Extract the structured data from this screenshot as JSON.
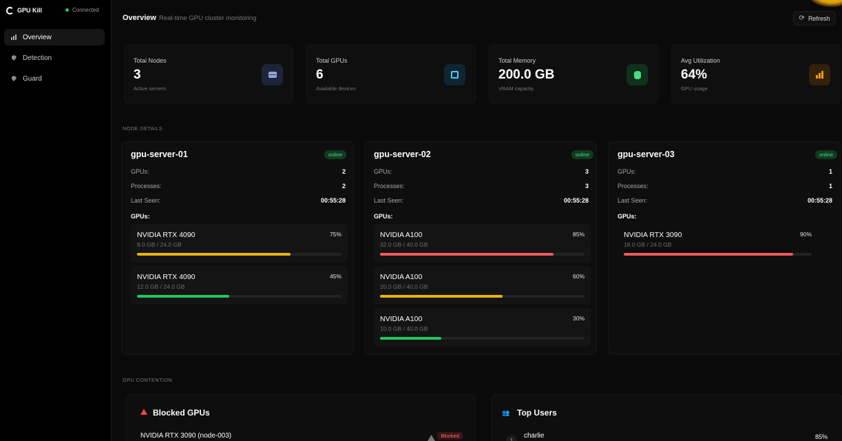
{
  "app": {
    "name": "GPU Kill",
    "status": "Connected"
  },
  "sidebar": {
    "items": [
      {
        "label": "Overview"
      },
      {
        "label": "Detection"
      },
      {
        "label": "Guard"
      }
    ]
  },
  "header": {
    "title": "Overview",
    "subtitle": "Real-time GPU cluster monitoring",
    "refresh_label": "Refresh"
  },
  "stats": [
    {
      "label": "Total Nodes",
      "value": "3",
      "sub": "Active servers",
      "icon": "server-icon",
      "color": "#93a7d8"
    },
    {
      "label": "Total GPUs",
      "value": "6",
      "sub": "Available devices",
      "icon": "chip-icon",
      "color": "#55c7f0"
    },
    {
      "label": "Total Memory",
      "value": "200.0 GB",
      "sub": "VRAM capacity",
      "icon": "database-icon",
      "color": "#4ade80"
    },
    {
      "label": "Avg Utilization",
      "value": "64%",
      "sub": "GPU usage",
      "icon": "bar-chart-icon",
      "color": "#f59e0b"
    }
  ],
  "node_section_label": "NODE DETAILS",
  "labels": {
    "gpus": "GPUs:",
    "processes": "Processes:",
    "last_seen": "Last Seen:",
    "gpus_head": "GPUs:"
  },
  "nodes": [
    {
      "name": "gpu-server-01",
      "status": "online",
      "gpus": "2",
      "processes": "2",
      "last_seen": "00:55:28",
      "gpu_list": [
        {
          "name": "NVIDIA RTX 4090",
          "memory": "8.0 GB / 24.0 GB",
          "pct": "75%",
          "util": 0.75,
          "color": "#eab308"
        },
        {
          "name": "NVIDIA RTX 4090",
          "memory": "12.0 GB / 24.0 GB",
          "pct": "45%",
          "util": 0.45,
          "color": "#22c55e"
        }
      ]
    },
    {
      "name": "gpu-server-02",
      "status": "online",
      "gpus": "3",
      "processes": "3",
      "last_seen": "00:55:28",
      "gpu_list": [
        {
          "name": "NVIDIA A100",
          "memory": "32.0 GB / 40.0 GB",
          "pct": "85%",
          "util": 0.85,
          "color": "#ef5b5b"
        },
        {
          "name": "NVIDIA A100",
          "memory": "20.0 GB / 40.0 GB",
          "pct": "60%",
          "util": 0.6,
          "color": "#eab308"
        },
        {
          "name": "NVIDIA A100",
          "memory": "10.0 GB / 40.0 GB",
          "pct": "30%",
          "util": 0.3,
          "color": "#22c55e"
        }
      ]
    },
    {
      "name": "gpu-server-03",
      "status": "online",
      "gpus": "1",
      "processes": "1",
      "last_seen": "00:55:28",
      "gpu_list": [
        {
          "name": "NVIDIA RTX 3090",
          "memory": "18.0 GB / 24.0 GB",
          "pct": "90%",
          "util": 0.9,
          "color": "#ef5b5b"
        }
      ]
    }
  ],
  "contention_label": "GPU CONTENTION",
  "blocked": {
    "title": "Blocked GPUs",
    "row_name": "NVIDIA RTX 3090 (node-003)",
    "badge": "Blocked"
  },
  "top_users": {
    "title": "Top Users",
    "rank": "1",
    "user": "charlie",
    "pct": "85%"
  }
}
